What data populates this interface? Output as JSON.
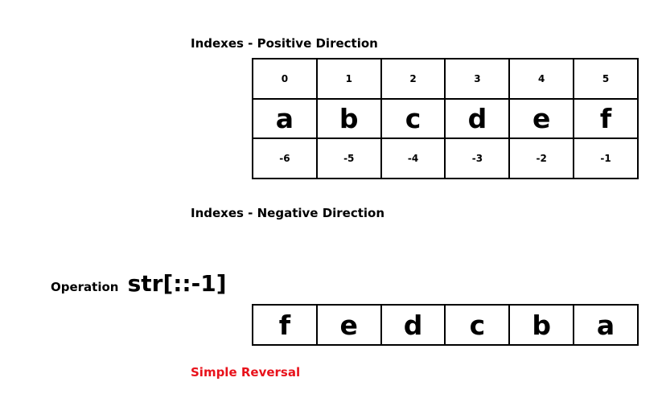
{
  "positive_title": "Indexes - Positive Direction",
  "negative_title": "Indexes - Negative Direction",
  "positive_indexes": [
    "0",
    "1",
    "2",
    "3",
    "4",
    "5"
  ],
  "characters": [
    "a",
    "b",
    "c",
    "d",
    "e",
    "f"
  ],
  "negative_indexes": [
    "-6",
    "-5",
    "-4",
    "-3",
    "-2",
    "-1"
  ],
  "operation": {
    "label": "Operation",
    "code": "str[::-1]"
  },
  "reversed_characters": [
    "f",
    "e",
    "d",
    "c",
    "b",
    "a"
  ],
  "reversal_label": "Simple Reversal",
  "colors": {
    "reversal_label": "#e8121b",
    "border": "#000000"
  }
}
